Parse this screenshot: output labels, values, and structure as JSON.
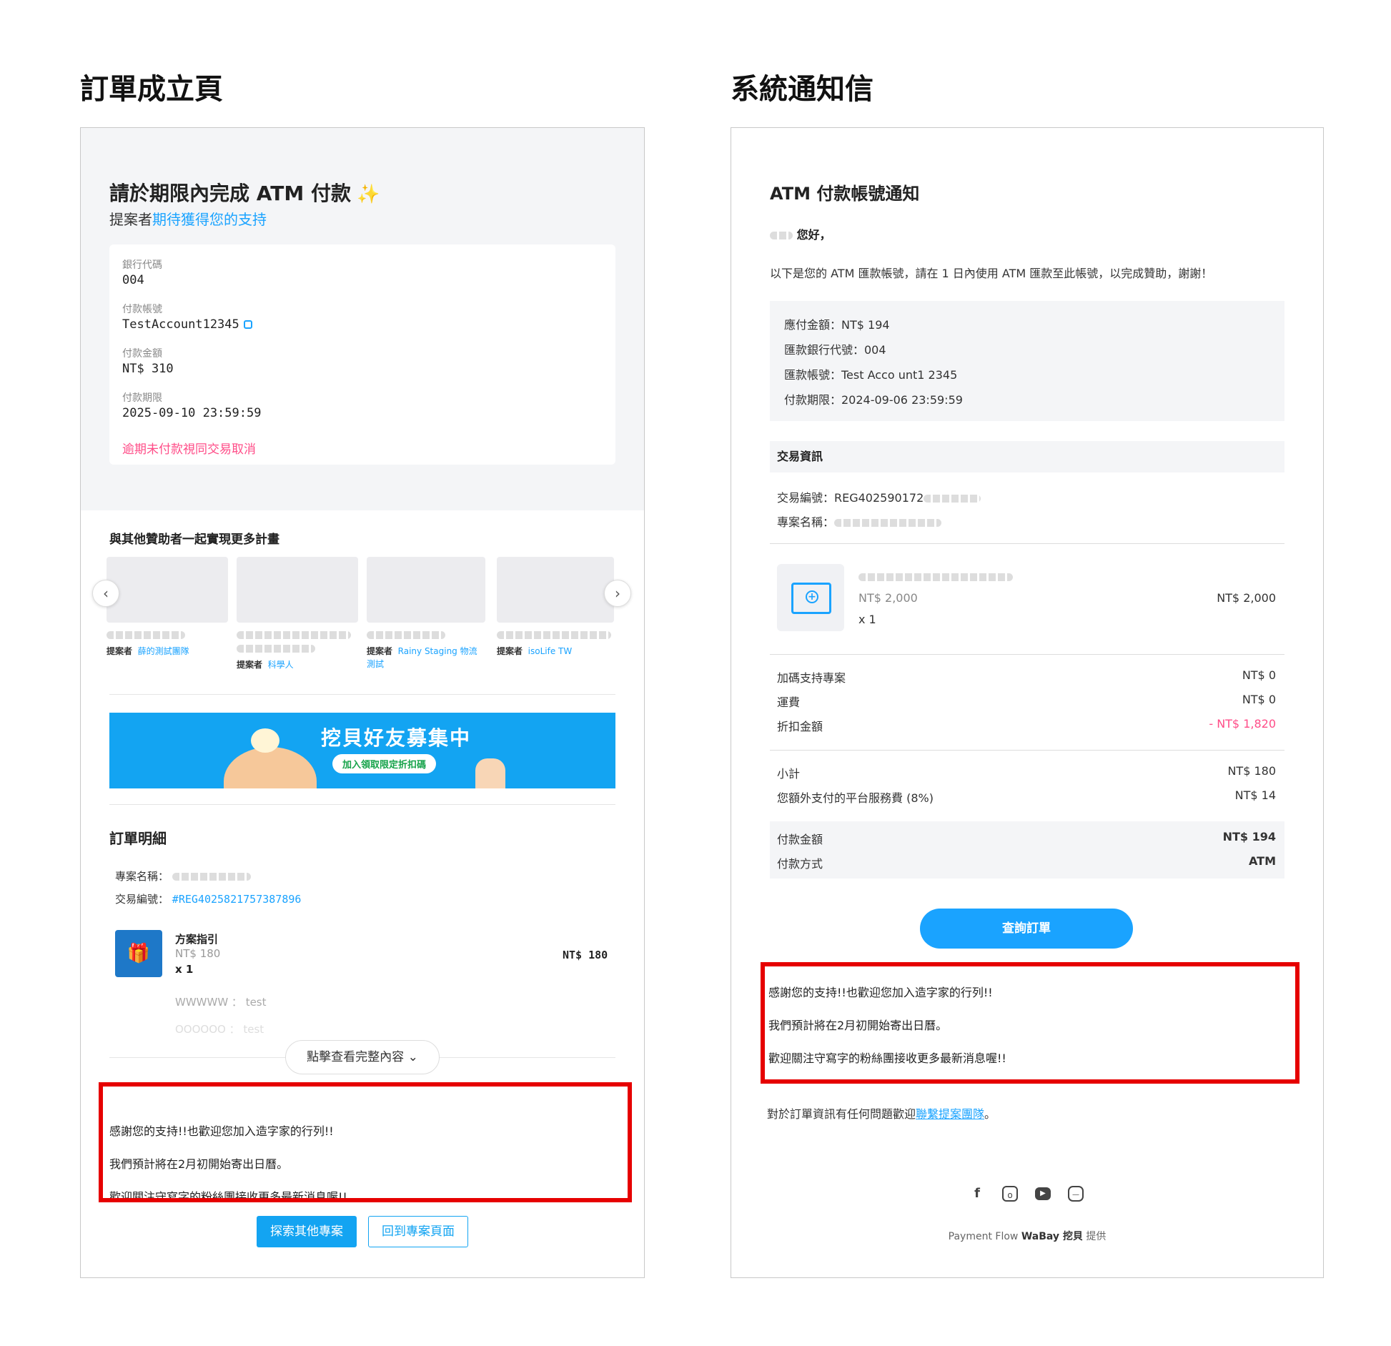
{
  "left_title": "訂單成立頁",
  "right_title": "系統通知信",
  "order_page": {
    "heading": "請於期限內完成 ATM 付款",
    "sparkle": "✨",
    "subtitle_prefix": "提案者",
    "subtitle_link": "期待獲得您的支持",
    "bank_code_label": "銀行代碼",
    "bank_code": "004",
    "account_label": "付款帳號",
    "account": "TestAccount12345",
    "amount_label": "付款金額",
    "amount": "NT$ 310",
    "deadline_label": "付款期限",
    "deadline": "2025-09-10 23:59:59",
    "warning": "逾期未付款視同交易取消",
    "recommend_title": "與其他贊助者一起實現更多計畫",
    "carousel_prev": "‹",
    "carousel_next": "›",
    "recommend_cards": [
      {
        "by": "提案者",
        "name": "薛的測試團隊"
      },
      {
        "by": "提案者",
        "name": "科學人"
      },
      {
        "by": "提案者",
        "name": "Rainy Staging 物流測試"
      },
      {
        "by": "提案者",
        "name": "isoLife TW"
      }
    ],
    "banner_title": "挖貝好友募集中",
    "banner_button": "加入領取限定折扣碼",
    "details_title": "訂單明細",
    "project_name_label": "專案名稱：",
    "txn_label": "交易編號：",
    "txn_no": "#REG4025821757387896",
    "product_icon": "🎁",
    "product_name": "方案指引",
    "product_price": "NT$ 180",
    "product_qty": "x 1",
    "product_total": "NT$ 180",
    "option1": "WWWWW ： test",
    "option2": "OOOOOO ： test",
    "expand_button": "點擊查看完整內容 ⌄",
    "message1": "感謝您的支持!!也歡迎您加入造字家的行列!!",
    "message2": "我們預計將在2月初開始寄出日曆。",
    "message3": "歡迎關注守寫字的粉絲團接收更多最新消息喔!!",
    "btn_explore": "探索其他專案",
    "btn_back": "回到專案頁面"
  },
  "email": {
    "heading": "ATM 付款帳號通知",
    "greeting": "您好，",
    "intro": "以下是您的 ATM 匯款帳號，請在 1 日內使用 ATM 匯款至此帳號，以完成贊助，謝謝！",
    "box_amount": "應付金額：NT$ 194",
    "box_bank": "匯款銀行代號：004",
    "box_account": "匯款帳號：Test Acco unt1 2345",
    "box_deadline": "付款期限：2024-09-06 23:59:59",
    "tx_header": "交易資訊",
    "tx_no": "交易編號：REG402590172",
    "tx_project": "專案名稱：",
    "prod_price": "NT$ 2,000",
    "prod_qty": "x 1",
    "prod_total": "NT$ 2,000",
    "addon_label": "加碼支持專案",
    "addon_value": "NT$ 0",
    "shipping_label": "運費",
    "shipping_value": "NT$ 0",
    "discount_label": "折扣金額",
    "discount_value": "- NT$ 1,820",
    "subtotal_label": "小計",
    "subtotal_value": "NT$ 180",
    "fee_label": "您額外支付的平台服務費 (8%)",
    "fee_value": "NT$ 14",
    "paid_label": "付款金額",
    "paid_value": "NT$ 194",
    "method_label": "付款方式",
    "method_value": "ATM",
    "query_button": "查詢訂單",
    "message1": "感謝您的支持!!也歡迎您加入造字家的行列!!",
    "message2": "我們預計將在2月初開始寄出日曆。",
    "message3": "歡迎關注守寫字的粉絲團接收更多最新消息喔!!",
    "contact_prefix": "對於訂單資訊有任何問題歡迎",
    "contact_link": "聯繫提案團隊",
    "contact_suffix": "。",
    "footer_prefix": "Payment Flow ",
    "footer_brand": "WaBay 挖貝",
    "footer_suffix": " 提供",
    "social_icons": [
      "facebook-icon",
      "instagram-icon",
      "youtube-icon",
      "line-icon"
    ]
  },
  "colors": {
    "accent": "#13a4f2",
    "warning": "#ff4d88",
    "highlight": "#e60000",
    "discount": "#ff4d88"
  }
}
